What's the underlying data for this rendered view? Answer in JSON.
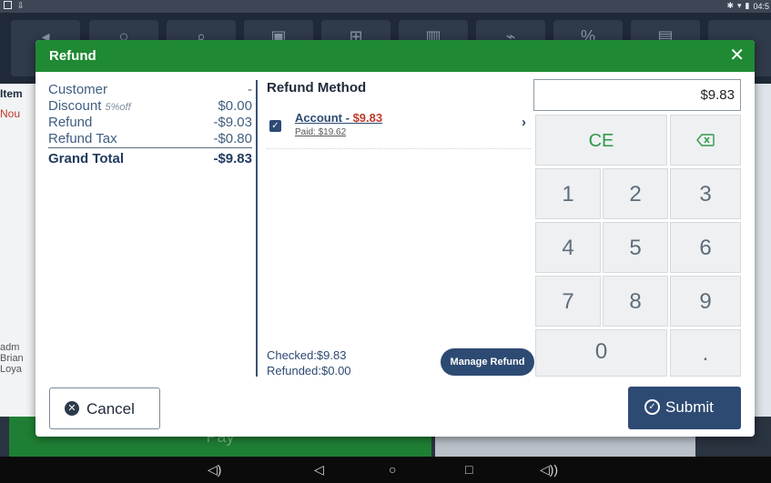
{
  "status_bar": {
    "time": "04:5"
  },
  "background": {
    "items_label": "Item",
    "no_label": "Nou",
    "admin_lines": [
      "adm",
      "Brian",
      "Loya"
    ],
    "pay_label": "Pay"
  },
  "dialog": {
    "title": "Refund",
    "close_icon": "close-icon"
  },
  "summary": {
    "rows": [
      {
        "label": "Customer",
        "sub": "",
        "value": "-"
      },
      {
        "label": "Discount",
        "sub": "5%off",
        "value": "$0.00"
      },
      {
        "label": "Refund",
        "sub": "",
        "value": "-$9.03"
      },
      {
        "label": "Refund Tax",
        "sub": "",
        "value": "-$0.80"
      }
    ],
    "grand_total": {
      "label": "Grand Total",
      "value": "-$9.83"
    }
  },
  "refund_method": {
    "title": "Refund Method",
    "entry": {
      "name": "Account - ",
      "amount": "$9.83",
      "paid": "Paid: $19.62",
      "checked": true
    },
    "checked_text": "Checked:$9.83",
    "refunded_text": "Refunded:$0.00",
    "manage_label": "Manage Refund"
  },
  "numpad": {
    "display": "$9.83",
    "keys": [
      "CE",
      "",
      "1",
      "2",
      "3",
      "4",
      "5",
      "6",
      "7",
      "8",
      "9",
      "0",
      "."
    ]
  },
  "buttons": {
    "cancel": "Cancel",
    "submit": "Submit"
  },
  "colors": {
    "header_green": "#1f8a33",
    "navy": "#2d4a73",
    "red": "#c0392b"
  }
}
